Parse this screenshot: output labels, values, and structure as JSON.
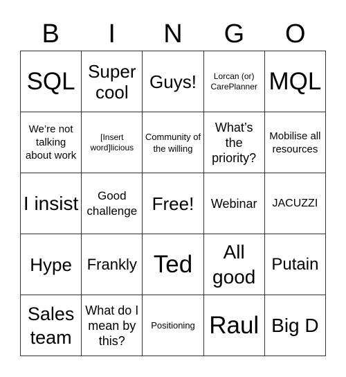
{
  "header": {
    "letters": [
      "B",
      "I",
      "N",
      "G",
      "O"
    ]
  },
  "cells": [
    "SQL",
    "Super cool",
    "Guys!",
    "Lorcan (or) CarePlanner",
    "MQL",
    "We’re not talking about work",
    "[Insert word]licious",
    "Community of the willing",
    "What’s the priority?",
    "Mobilise all resources",
    "I insist",
    "Good challenge",
    "Free!",
    "Webinar",
    "JACUZZI",
    "Hype",
    "Frankly",
    "Ted",
    "All good",
    "Putain",
    "Sales team",
    "What do I mean by this?",
    "Positioning",
    "Raul",
    "Big D"
  ]
}
